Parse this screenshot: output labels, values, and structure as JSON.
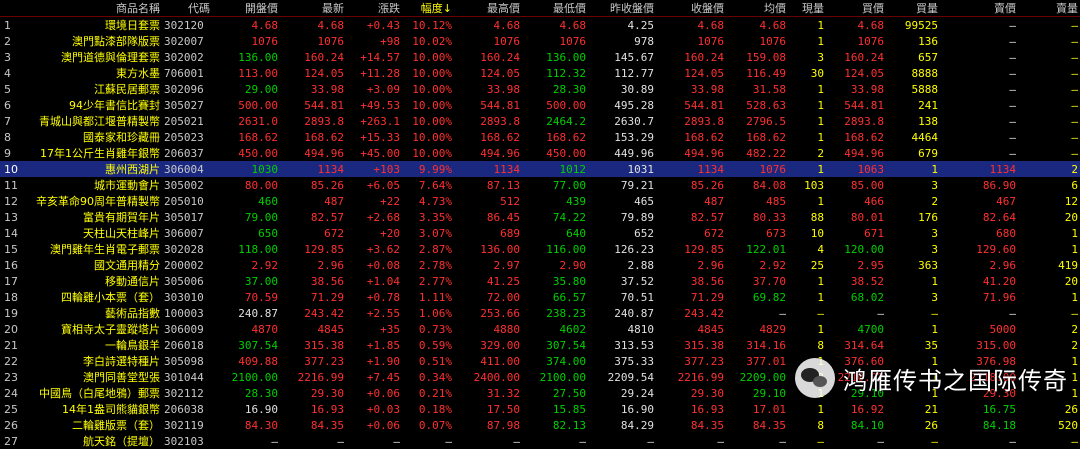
{
  "headers": [
    "",
    "商品名稱",
    "代碼",
    "開盤價",
    "最新",
    "漲跌",
    "幅度↓",
    "最高價",
    "最低價",
    "昨收盤價",
    "收盤價",
    "均價",
    "現量",
    "買價",
    "買量",
    "賣價",
    "賣量"
  ],
  "rows": [
    [
      "1",
      "環境日套票",
      "302120",
      "4.68",
      "4.68",
      "+0.43",
      "10.12%",
      "4.68",
      "4.68",
      "4.25",
      "4.68",
      "4.68",
      "1",
      "4.68",
      "99525",
      "—",
      "—"
    ],
    [
      "2",
      "澳門點漆部隊版票",
      "302007",
      "1076",
      "1076",
      "+98",
      "10.02%",
      "1076",
      "1076",
      "978",
      "1076",
      "1076",
      "1",
      "1076",
      "136",
      "—",
      "—"
    ],
    [
      "3",
      "澳門道德與倫理套票",
      "302002",
      "136.00",
      "160.24",
      "+14.57",
      "10.00%",
      "160.24",
      "136.00",
      "145.67",
      "160.24",
      "159.08",
      "3",
      "160.24",
      "657",
      "—",
      "—"
    ],
    [
      "4",
      "東方水墨",
      "706001",
      "113.00",
      "124.05",
      "+11.28",
      "10.00%",
      "124.05",
      "112.32",
      "112.77",
      "124.05",
      "116.49",
      "30",
      "124.05",
      "8888",
      "—",
      "—"
    ],
    [
      "5",
      "江蘇民居郵票",
      "302096",
      "29.00",
      "33.98",
      "+3.09",
      "10.00%",
      "33.98",
      "28.30",
      "30.89",
      "33.98",
      "31.58",
      "1",
      "33.98",
      "5888",
      "—",
      "—"
    ],
    [
      "6",
      "94少年書信比賽封",
      "305027",
      "500.00",
      "544.81",
      "+49.53",
      "10.00%",
      "544.81",
      "500.00",
      "495.28",
      "544.81",
      "528.63",
      "1",
      "544.81",
      "241",
      "—",
      "—"
    ],
    [
      "7",
      "青城山與都江堰普精製幣",
      "205021",
      "2631.0",
      "2893.8",
      "+263.1",
      "10.00%",
      "2893.8",
      "2464.2",
      "2630.7",
      "2893.8",
      "2796.5",
      "1",
      "2893.8",
      "138",
      "—",
      "—"
    ],
    [
      "8",
      "國泰家和珍藏冊",
      "205023",
      "168.62",
      "168.62",
      "+15.33",
      "10.00%",
      "168.62",
      "168.62",
      "153.29",
      "168.62",
      "168.62",
      "1",
      "168.62",
      "4464",
      "—",
      "—"
    ],
    [
      "9",
      "17年1公斤生肖雞年銀幣",
      "206037",
      "450.00",
      "494.96",
      "+45.00",
      "10.00%",
      "494.96",
      "450.00",
      "449.96",
      "494.96",
      "482.22",
      "2",
      "494.96",
      "679",
      "—",
      "—"
    ],
    [
      "10",
      "惠州西湖片",
      "306004",
      "1030",
      "1134",
      "+103",
      "9.99%",
      "1134",
      "1012",
      "1031",
      "1134",
      "1076",
      "1",
      "1063",
      "1",
      "1134",
      "2"
    ],
    [
      "11",
      "城市運動會片",
      "305002",
      "80.00",
      "85.26",
      "+6.05",
      "7.64%",
      "87.13",
      "77.00",
      "79.21",
      "85.26",
      "84.08",
      "103",
      "85.00",
      "3",
      "86.90",
      "6"
    ],
    [
      "12",
      "辛亥革命90周年普精製幣",
      "205010",
      "460",
      "487",
      "+22",
      "4.73%",
      "512",
      "439",
      "465",
      "487",
      "485",
      "1",
      "466",
      "2",
      "467",
      "12"
    ],
    [
      "13",
      "富貴有期賀年片",
      "305017",
      "79.00",
      "82.57",
      "+2.68",
      "3.35%",
      "86.45",
      "74.22",
      "79.89",
      "82.57",
      "80.33",
      "88",
      "80.01",
      "176",
      "82.64",
      "20"
    ],
    [
      "14",
      "天柱山天柱峰片",
      "306007",
      "650",
      "672",
      "+20",
      "3.07%",
      "689",
      "640",
      "652",
      "672",
      "673",
      "10",
      "671",
      "3",
      "680",
      "1"
    ],
    [
      "15",
      "澳門雞年生肖電子郵票",
      "302028",
      "118.00",
      "129.85",
      "+3.62",
      "2.87%",
      "136.00",
      "116.00",
      "126.23",
      "129.85",
      "122.01",
      "4",
      "120.00",
      "3",
      "129.60",
      "1"
    ],
    [
      "16",
      "國文通用精分",
      "200002",
      "2.92",
      "2.96",
      "+0.08",
      "2.78%",
      "2.97",
      "2.90",
      "2.88",
      "2.96",
      "2.92",
      "25",
      "2.95",
      "363",
      "2.96",
      "419"
    ],
    [
      "17",
      "移動通信片",
      "305006",
      "37.00",
      "38.56",
      "+1.04",
      "2.77%",
      "41.25",
      "35.80",
      "37.52",
      "38.56",
      "37.70",
      "1",
      "38.52",
      "1",
      "41.20",
      "20"
    ],
    [
      "18",
      "四輪雞小本票（套）",
      "303010",
      "70.59",
      "71.29",
      "+0.78",
      "1.11%",
      "72.00",
      "66.57",
      "70.51",
      "71.29",
      "69.82",
      "1",
      "68.02",
      "3",
      "71.96",
      "1"
    ],
    [
      "19",
      "藝術品指數",
      "100003",
      "240.87",
      "243.42",
      "+2.55",
      "1.06%",
      "253.66",
      "238.23",
      "240.87",
      "243.42",
      "—",
      "—",
      "—",
      "—",
      "—",
      "—"
    ],
    [
      "20",
      "寶相寺太子靈蹤塔片",
      "306009",
      "4870",
      "4845",
      "+35",
      "0.73%",
      "4880",
      "4602",
      "4810",
      "4845",
      "4829",
      "1",
      "4700",
      "1",
      "5000",
      "2"
    ],
    [
      "21",
      "一輪鳥銀羊",
      "206018",
      "307.54",
      "315.38",
      "+1.85",
      "0.59%",
      "329.00",
      "307.54",
      "313.53",
      "315.38",
      "314.16",
      "8",
      "314.64",
      "35",
      "315.00",
      "2"
    ],
    [
      "22",
      "李白詩選特種片",
      "305098",
      "409.88",
      "377.23",
      "+1.90",
      "0.51%",
      "411.00",
      "374.00",
      "375.33",
      "377.23",
      "377.01",
      "1",
      "376.60",
      "1",
      "376.98",
      "1"
    ],
    [
      "23",
      "澳門同善堂型張",
      "301044",
      "2100.00",
      "2216.99",
      "+7.45",
      "0.34%",
      "2400.00",
      "2100.00",
      "2209.54",
      "2216.99",
      "2209.00",
      "12",
      "2210.02",
      "1",
      "2218.00",
      "1"
    ],
    [
      "24",
      "中國鳥（白尾地鴉）郵票",
      "302112",
      "28.30",
      "29.30",
      "+0.06",
      "0.21%",
      "31.32",
      "27.50",
      "29.24",
      "29.30",
      "29.10",
      "1",
      "29.10",
      "1",
      "29.30",
      "1"
    ],
    [
      "25",
      "14年1盎司熊貓銀幣",
      "206038",
      "16.90",
      "16.93",
      "+0.03",
      "0.18%",
      "17.50",
      "15.85",
      "16.90",
      "16.93",
      "17.01",
      "1",
      "16.92",
      "21",
      "16.75",
      "26"
    ],
    [
      "26",
      "二輪雞版票（套）",
      "302119",
      "84.30",
      "84.35",
      "+0.06",
      "0.07%",
      "87.98",
      "82.13",
      "84.29",
      "84.35",
      "84.35",
      "8",
      "84.10",
      "26",
      "84.18",
      "520"
    ],
    [
      "27",
      "航天銘（提壇）",
      "302103",
      "—",
      "—",
      "—",
      "—",
      "—",
      "—",
      "—",
      "—",
      "—",
      "—",
      "—",
      "—",
      "—",
      "—"
    ]
  ],
  "colors": {
    "up": "#ff3030",
    "down": "#00d000",
    "flat": "#e0e0e0",
    "name": "#ffff00",
    "selected_row_bg": "#1a2880"
  },
  "watermark": {
    "icon": "wechat-icon",
    "text": "鸿雁传书之国际传奇"
  }
}
